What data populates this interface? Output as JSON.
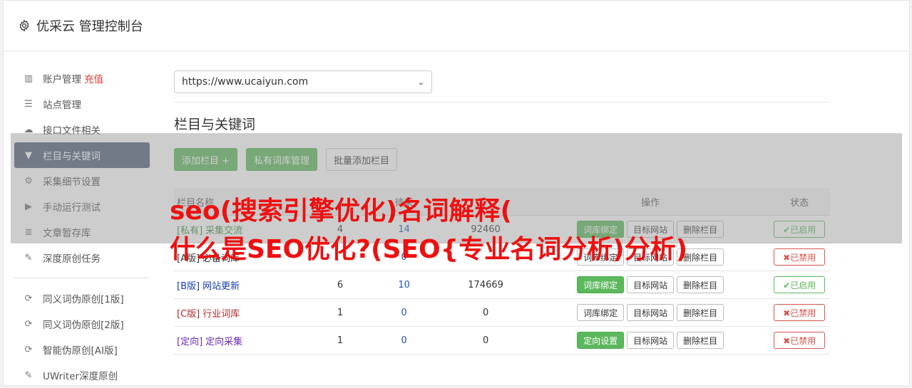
{
  "header": {
    "title": "优采云 管理控制台",
    "icon": "gear-icon"
  },
  "sidebar": {
    "items": [
      {
        "label": "账户管理",
        "extra": "充值",
        "icon": "bar-chart-icon"
      },
      {
        "label": "站点管理",
        "icon": "server-icon"
      },
      {
        "label": "接口文件相关",
        "icon": "cloud-upload-icon"
      },
      {
        "label": "栏目与关键词",
        "icon": "filter-icon",
        "active": true
      },
      {
        "label": "采集细节设置",
        "icon": "cogs-icon"
      },
      {
        "label": "手动运行测试",
        "icon": "play-icon"
      },
      {
        "label": "文章暂存库",
        "icon": "database-icon"
      },
      {
        "label": "深度原创任务",
        "icon": "edit-icon"
      }
    ],
    "items2": [
      {
        "label": "同义词伪原创[1版]",
        "icon": "refresh-icon"
      },
      {
        "label": "同义词伪原创[2版]",
        "icon": "refresh-icon"
      },
      {
        "label": "智能伪原创[AI版]",
        "icon": "refresh-icon"
      },
      {
        "label": "UWriter深度原创",
        "icon": "edit-icon"
      }
    ]
  },
  "site_select": {
    "value": "https://www.ucaiyun.com"
  },
  "section": {
    "title": "栏目与关键词"
  },
  "toolbar": {
    "add": "添加栏目 +",
    "private": "私有词库管理",
    "batch": "批量添加栏目"
  },
  "table": {
    "headers": [
      "栏目名称",
      "",
      "待采",
      "",
      "操作",
      "状态"
    ],
    "rows": [
      {
        "tag": "[私有]",
        "name": "采集交流",
        "a": "4",
        "b": "14",
        "c": "92460",
        "op1": "词库绑定",
        "op2": "目标网站",
        "op3": "删除栏目",
        "status": "✔已启用",
        "on": true,
        "color": "#3c8d3c"
      },
      {
        "tag": "[A版]",
        "name": "必备词库",
        "a": "",
        "b": "0",
        "c": "",
        "op1": "词库绑定",
        "op2": "目标网站",
        "op3": "删除栏目",
        "status": "✖已禁用",
        "on": false,
        "color": "#333333"
      },
      {
        "tag": "[B版]",
        "name": "网站更新",
        "a": "6",
        "b": "10",
        "c": "174669",
        "op1": "词库绑定",
        "op2": "目标网站",
        "op3": "删除栏目",
        "status": "✔已启用",
        "on": true,
        "color": "#1a3fb5"
      },
      {
        "tag": "[C版]",
        "name": "行业词库",
        "a": "1",
        "b": "0",
        "c": "0",
        "op1": "词库绑定",
        "op2": "目标网站",
        "op3": "删除栏目",
        "status": "✖已禁用",
        "on": false,
        "color": "#b52a2a"
      },
      {
        "tag": "[定向]",
        "name": "定向采集",
        "a": "1",
        "b": "0",
        "c": "0",
        "op1": "定向设置",
        "op2": "目标网站",
        "op3": "删除栏目",
        "status": "✖已禁用",
        "on": false,
        "color": "#6a2ab5"
      }
    ]
  },
  "overlay": {
    "line1": "seo(搜索引擎优化)名词解释(",
    "line2": "什么是SEO优化?(SEO{专业名词分析)分析)"
  }
}
